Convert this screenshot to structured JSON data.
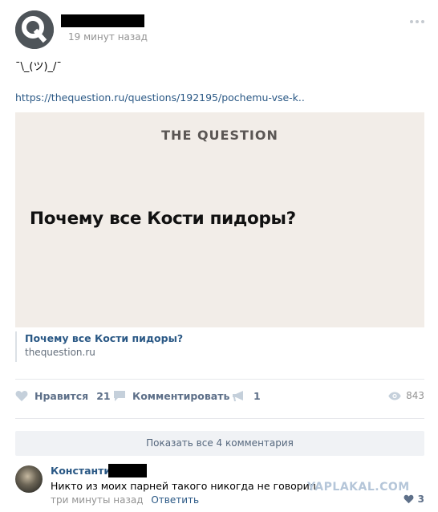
{
  "post": {
    "time": "19 минут назад",
    "text": "¯\\_(ツ)_/¯",
    "link": "https://thequestion.ru/questions/192195/pochemu-vse-k..",
    "snippet": {
      "brand": "THE QUESTION",
      "headline": "Почему все Кости пидоры?",
      "title": "Почему все Кости пидоры?",
      "domain": "thequestion.ru"
    },
    "actions": {
      "like_label": "Нравится",
      "like_count": "21",
      "comment_label": "Комментировать",
      "share_count": "1",
      "views": "843"
    }
  },
  "comments": {
    "show_all_label": "Показать все 4 комментария",
    "items": [
      {
        "author": "Константин",
        "text": "Никто из моих парней такого никогда не говорил",
        "time": "три минуты назад",
        "reply_label": "Ответить",
        "likes": "3"
      }
    ]
  },
  "watermark": "YAPLAKAL.COM",
  "colors": {
    "link": "#2a5885",
    "muted": "#939393",
    "action": "#5e7089",
    "snippet_bg": "#f2ede8"
  },
  "icons": [
    "q-logo-icon",
    "more-dots-icon",
    "heart-icon",
    "comment-icon",
    "megaphone-share-icon",
    "eye-icon"
  ]
}
